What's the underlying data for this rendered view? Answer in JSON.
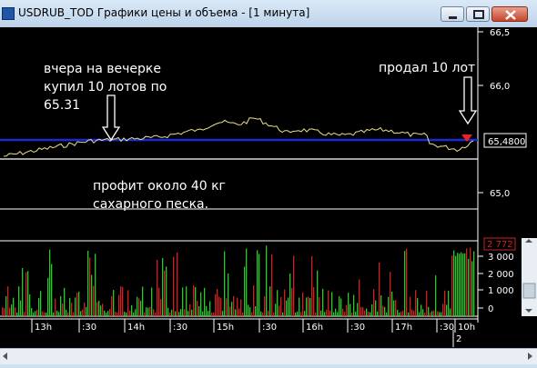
{
  "window": {
    "title": "USDRUB_TOD Графики цены и объема - [1 минута]"
  },
  "price_axis": {
    "ticks": [
      "66,5",
      "66,0",
      "65,0"
    ],
    "current_price_label": "65,4800"
  },
  "volume_axis": {
    "ticks": [
      "3 000",
      "2 000",
      "1 000",
      "0"
    ],
    "max_label": "2 772"
  },
  "time_axis": {
    "ticks": [
      "13h",
      ":30",
      "14h",
      ":30",
      "15h",
      ":30",
      "16h",
      ":30",
      "17h",
      ":30",
      "10h"
    ],
    "sub_label": "2"
  },
  "annotations": {
    "buy": "вчера на вечерке\nкупил 10 лотов по\n65.31",
    "sell": "продал 10 лот",
    "profit": "профит около 40 кг\nсахарного песка."
  },
  "colors": {
    "price_line": "#e8e08a",
    "current_price_line": "#1a2bd6",
    "volume_up": "#28c828",
    "volume_down": "#cc2222",
    "axis_text": "#ffffff",
    "background": "#000000"
  }
}
